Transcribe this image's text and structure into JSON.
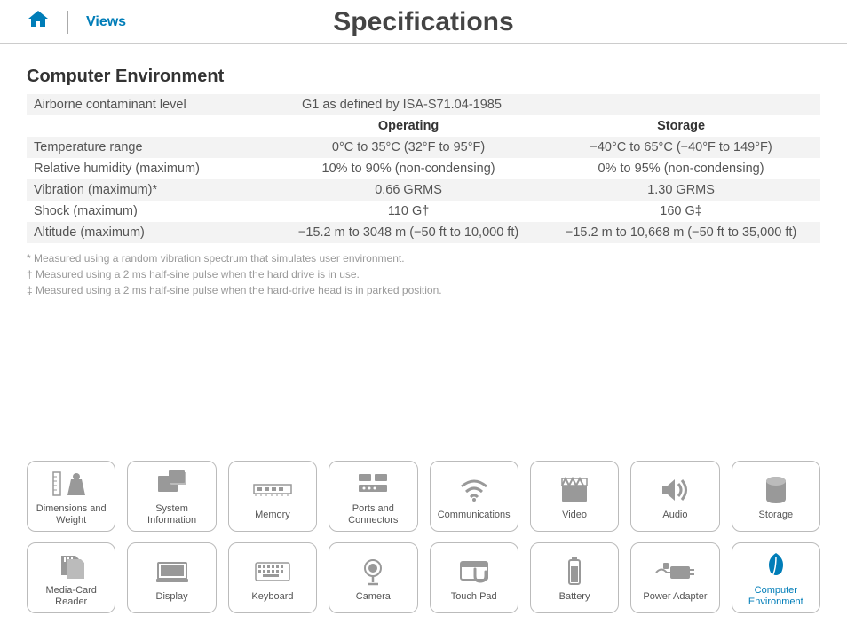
{
  "header": {
    "views": "Views",
    "title": "Specifications"
  },
  "section": {
    "title": "Computer Environment",
    "row1_label": "Airborne contaminant level",
    "row1_value": "G1 as defined by ISA-S71.04-1985",
    "col_operating": "Operating",
    "col_storage": "Storage",
    "rows": {
      "temp": {
        "label": "Temperature range",
        "op": "0°C to 35°C (32°F to 95°F)",
        "st": "−40°C to 65°C (−40°F to 149°F)"
      },
      "humidity": {
        "label": "Relative humidity (maximum)",
        "op": "10% to 90% (non-condensing)",
        "st": "0% to 95% (non-condensing)"
      },
      "vibration": {
        "label": "Vibration (maximum)*",
        "op": "0.66 GRMS",
        "st": "1.30 GRMS"
      },
      "shock": {
        "label": "Shock (maximum)",
        "op": "110 G†",
        "st": "160 G‡"
      },
      "altitude": {
        "label": "Altitude (maximum)",
        "op": "−15.2 m to 3048 m (−50 ft to 10,000 ft)",
        "st": "−15.2 m to 10,668 m (−50 ft to 35,000 ft)"
      }
    },
    "footnotes": {
      "f1": "* Measured using a random vibration spectrum that simulates user environment.",
      "f2": "† Measured using a 2 ms half-sine pulse when the hard drive is in use.",
      "f3": "‡ Measured using a 2 ms half-sine pulse when the hard-drive head is in parked position."
    }
  },
  "nav": {
    "r1": {
      "t0": "Dimensions and Weight",
      "t1": "System Information",
      "t2": "Memory",
      "t3": "Ports and Connectors",
      "t4": "Communications",
      "t5": "Video",
      "t6": "Audio",
      "t7": "Storage"
    },
    "r2": {
      "t0": "Media-Card Reader",
      "t1": "Display",
      "t2": "Keyboard",
      "t3": "Camera",
      "t4": "Touch Pad",
      "t5": "Battery",
      "t6": "Power Adapter",
      "t7": "Computer Environment"
    }
  }
}
